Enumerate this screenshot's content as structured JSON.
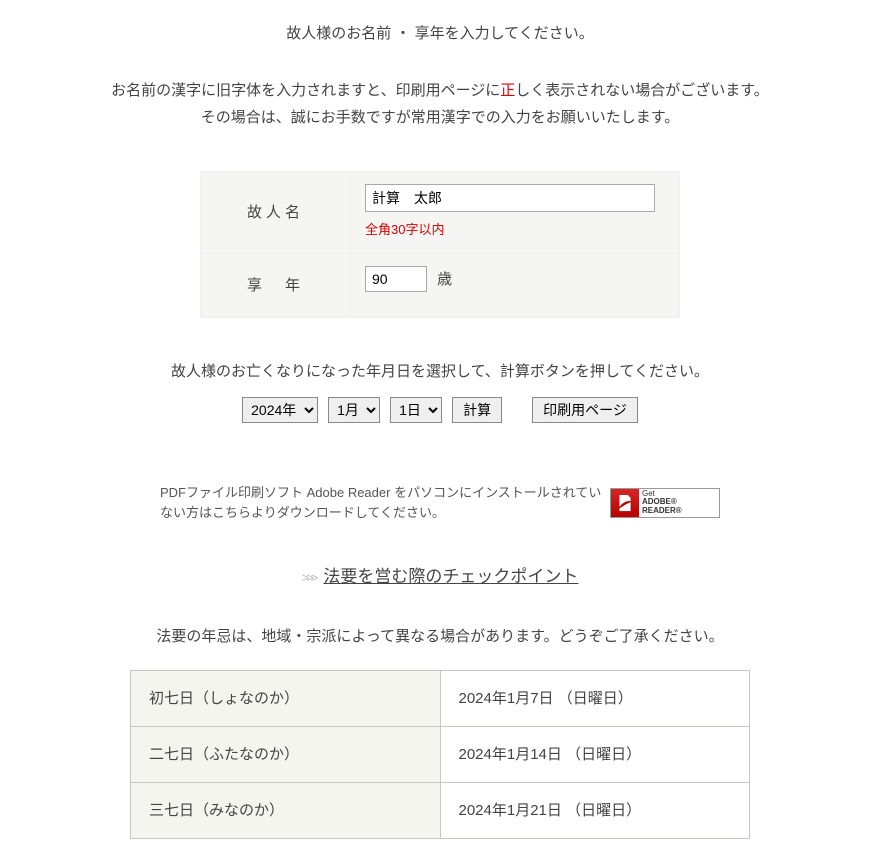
{
  "intro": {
    "line1": "故人様のお名前 ・ 享年を入力してください。",
    "line2_parts": {
      "pre": "お名前の漢字に旧字体を入力されますと、印刷用ページに",
      "hl": "正",
      "post": "しく表示されない場合がございます。"
    },
    "line3": "その場合は、誠にお手数ですが常用漢字での入力をお願いいたします。"
  },
  "form": {
    "name_label": "故人名",
    "name_value": "計算　太郎",
    "name_constraint": "全角30字以内",
    "age_label": "享　年",
    "age_value": "90",
    "age_suffix": "歳"
  },
  "date_section": {
    "heading": "故人様のお亡くなりになった年月日を選択して、計算ボタンを押してください。",
    "year": "2024年",
    "month": "1月",
    "day": "1日",
    "calc_label": "計算",
    "print_label": "印刷用ページ"
  },
  "pdf": {
    "text": "PDFファイル印刷ソフト Adobe Reader をパソコンにインストールされていない方はこちらよりダウンロードしてください。",
    "badge_line1": "Get",
    "badge_line2": "ADOBE® READER®"
  },
  "checkpoint": {
    "arrow": ">>>",
    "label": "法要を営む際のチェックポイント"
  },
  "disclaimer": "法要の年忌は、地域・宗派によって異なる場合があります。どうぞご了承ください。",
  "memorial_rows": [
    {
      "name": "初七日（しょなのか）",
      "date": "2024年1月7日 （日曜日）"
    },
    {
      "name": "二七日（ふたなのか）",
      "date": "2024年1月14日 （日曜日）"
    },
    {
      "name": "三七日（みなのか）",
      "date": "2024年1月21日 （日曜日）"
    }
  ]
}
